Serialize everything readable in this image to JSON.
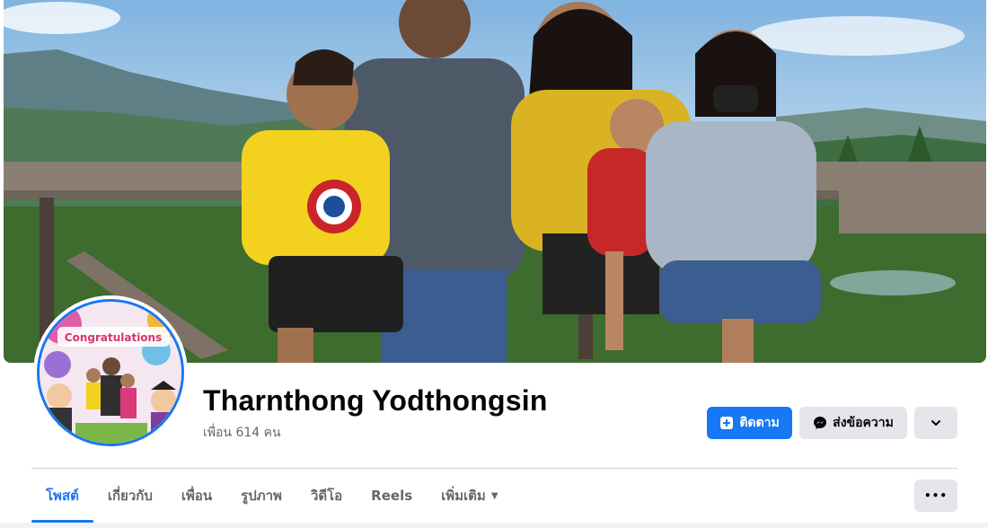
{
  "profile": {
    "name": "Tharnthong Yodthongsin",
    "friends_text": "เพื่อน 614 คน"
  },
  "actions": {
    "follow_label": "ติดตาม",
    "message_label": "ส่งข้อความ",
    "follow_icon": "follow-add-icon",
    "message_icon": "messenger-icon",
    "more_icon": "chevron-down-icon"
  },
  "tabs": [
    {
      "label": "โพสต์",
      "active": true
    },
    {
      "label": "เกี่ยวกับ",
      "active": false
    },
    {
      "label": "เพื่อน",
      "active": false
    },
    {
      "label": "รูปภาพ",
      "active": false
    },
    {
      "label": "วิดีโอ",
      "active": false
    },
    {
      "label": "Reels",
      "active": false
    },
    {
      "label": "เพิ่มเติม",
      "active": false
    }
  ],
  "tabs_more_label": "•••",
  "avatar_banner_text": "Congratulations",
  "colors": {
    "accent": "#1877f2",
    "secondary_button": "#e4e6eb",
    "muted_text": "#65676b",
    "primary_text": "#050505"
  }
}
